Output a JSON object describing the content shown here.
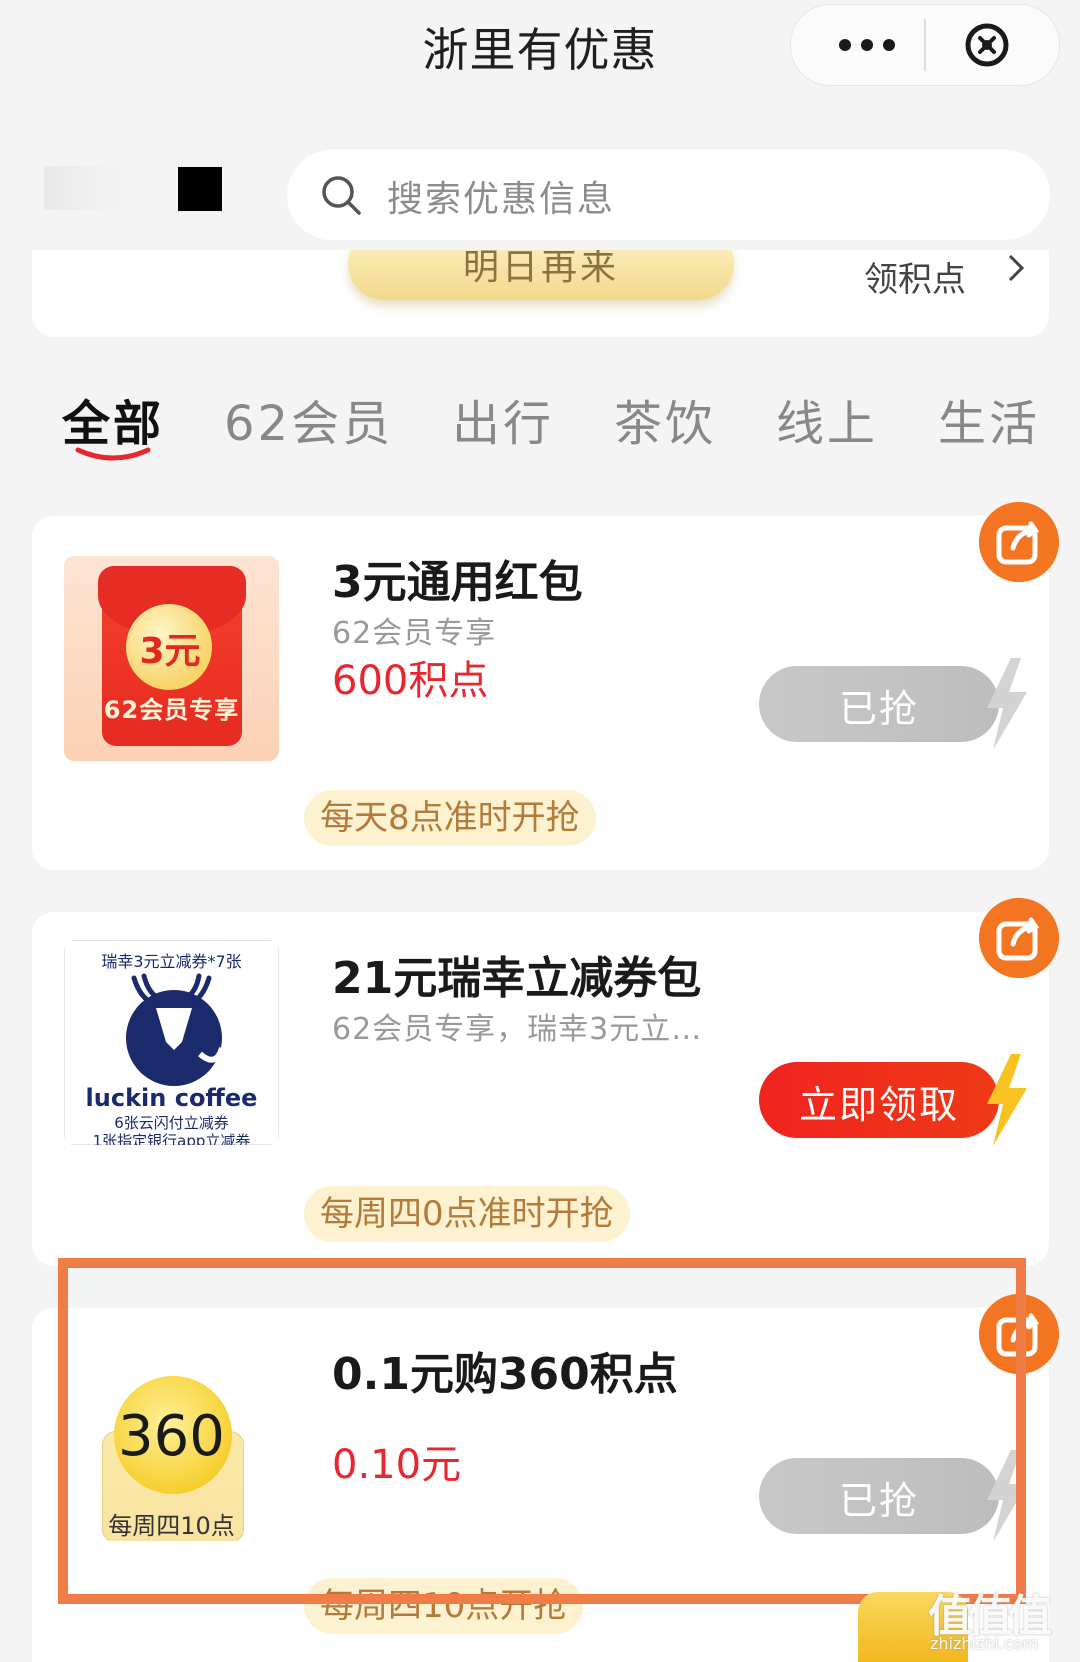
{
  "header": {
    "title": "浙里有优惠",
    "more_icon": "more-dots-icon",
    "close_icon": "close-circle-icon"
  },
  "search": {
    "placeholder": "搜索优惠信息",
    "icon": "search-icon"
  },
  "signin": {
    "button_label": "明日再来",
    "points_link": "领积点"
  },
  "tabs": [
    {
      "label": "全部",
      "active": true
    },
    {
      "label": "62会员",
      "active": false
    },
    {
      "label": "出行",
      "active": false
    },
    {
      "label": "茶饮",
      "active": false
    },
    {
      "label": "线上",
      "active": false
    },
    {
      "label": "生活",
      "active": false
    }
  ],
  "offers": [
    {
      "title": "3元通用红包",
      "subtitle": "62会员专享",
      "price": "600积点",
      "button_label": "已抢",
      "button_state": "grabbed",
      "schedule": "每天8点准时开抢",
      "thumb": {
        "amount": "3元",
        "caption": "62会员专享"
      }
    },
    {
      "title": "21元瑞幸立减券包",
      "subtitle": "62会员专享，瑞幸3元立…",
      "price": "",
      "button_label": "立即领取",
      "button_state": "available",
      "schedule": "每周四0点准时开抢",
      "thumb": {
        "top_text": "瑞幸3元立减券*7张",
        "brand": "luckin coffee",
        "line1": "6张云闪付立减券",
        "line2": "1张指定银行app立减券"
      }
    },
    {
      "title": "0.1元购360积点",
      "subtitle": "",
      "price": "0.10元",
      "button_label": "已抢",
      "button_state": "grabbed",
      "schedule": "每周四10点开抢",
      "thumb": {
        "number": "360",
        "caption": "每周四10点"
      }
    }
  ],
  "watermark": {
    "text": "值值值",
    "sub": "zhizhizhi.com"
  },
  "colors": {
    "accent_red": "#e8262d",
    "share_orange": "#f37421",
    "highlight_orange": "#f07c47",
    "schedule_bg": "#fcf2cf",
    "schedule_text": "#b47a3c"
  }
}
